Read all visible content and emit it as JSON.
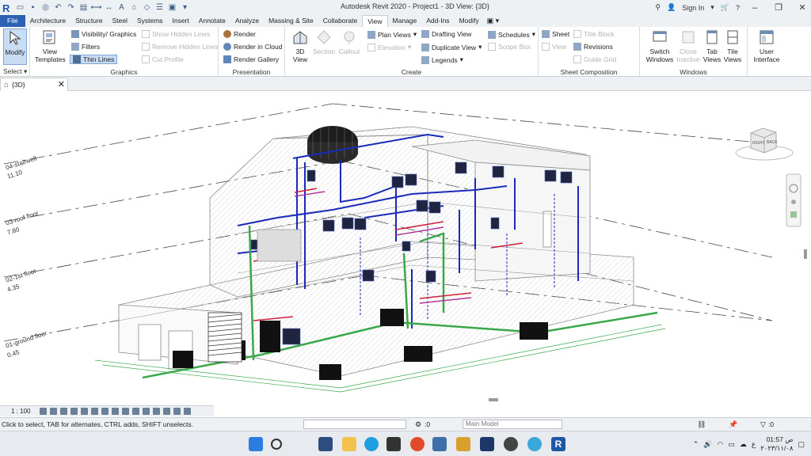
{
  "app": {
    "title": "Autodesk Revit 2020 - Project1 - 3D View: {3D}",
    "sign_in": "Sign In"
  },
  "tabs": [
    "File",
    "Architecture",
    "Structure",
    "Steel",
    "Systems",
    "Insert",
    "Annotate",
    "Analyze",
    "Massing & Site",
    "Collaborate",
    "View",
    "Manage",
    "Add-Ins",
    "Modify"
  ],
  "active_tab": "View",
  "ribbon": {
    "select": {
      "modify": "Modify",
      "select_label": "Select"
    },
    "graphics": {
      "view_templates": "View Templates",
      "visibility_graphics": "Visibility/ Graphics",
      "filters": "Filters",
      "thin_lines": "Thin Lines",
      "show_hidden_lines": "Show Hidden Lines",
      "remove_hidden_lines": "Remove Hidden Lines",
      "cut_profile": "Cut Profile",
      "label": "Graphics"
    },
    "presentation": {
      "render": "Render",
      "render_in_cloud": "Render in Cloud",
      "render_gallery": "Render Gallery",
      "label": "Presentation"
    },
    "create": {
      "view_3d": "3D View",
      "section": "Section",
      "callout": "Callout",
      "plan_views": "Plan Views",
      "elevation": "Elevation",
      "drafting_view": "Drafting View",
      "duplicate_view": "Duplicate View",
      "legends": "Legends",
      "schedules": "Schedules",
      "scope_box": "Scope Box",
      "label": "Create"
    },
    "sheet_composition": {
      "sheet": "Sheet",
      "title_block": "Title Block",
      "view": "View",
      "revisions": "Revisions",
      "guide_grid": "Guide Grid",
      "label": "Sheet Composition"
    },
    "windows": {
      "switch_windows": "Switch Windows",
      "close_inactive": "Close Inactive",
      "tab_views": "Tab Views",
      "tile_views": "Tile Views",
      "label": "Windows"
    },
    "user_interface": "User Interface"
  },
  "view_tab": {
    "label": "{3D}"
  },
  "levels": [
    {
      "name": "04-stairwell",
      "elevation": "11.10"
    },
    {
      "name": "03-roof floor",
      "elevation": "7.80"
    },
    {
      "name": "02-1st floor",
      "elevation": "4.35"
    },
    {
      "name": "01-ground floor",
      "elevation": "0.45"
    }
  ],
  "viewcube": {
    "right": "RIGHT",
    "back": "BACK"
  },
  "view_control": {
    "scale": "1 : 100"
  },
  "status": {
    "message": "Click to select, TAB for alternates, CTRL adds, SHIFT unselects.",
    "worksets": ":0",
    "model": "Main Model",
    "filter_count": ":0"
  },
  "taskbar": {
    "time": "01:57 ص",
    "date": "٢٠٢٣/١١/٠٨",
    "lang": "ع"
  },
  "colors": {
    "file_tab": "#2b62b4",
    "duct_blue": "#1a2bb8",
    "pipe_green": "#3aa84a",
    "pipe_red": "#d0203a",
    "pipe_magenta": "#b0309a"
  }
}
